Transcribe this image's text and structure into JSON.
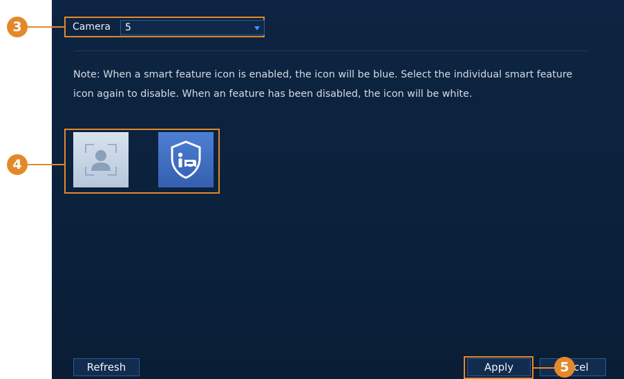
{
  "camera": {
    "label": "Camera",
    "value": "5"
  },
  "note": "Note: When a smart feature icon is enabled, the icon will be blue. Select the individual smart feature icon again to disable. When an feature has been disabled, the icon will be white.",
  "features": [
    {
      "name": "face-detection",
      "state": "disabled"
    },
    {
      "name": "vehicle-detection",
      "state": "enabled"
    }
  ],
  "buttons": {
    "refresh": "Refresh",
    "apply": "Apply",
    "cancel_visible": "cel"
  },
  "callouts": {
    "c3": "3",
    "c4": "4",
    "c5": "5"
  },
  "colors": {
    "panel": "#0c223e",
    "accent_orange": "#e3892a",
    "enabled_blue": "#4a7bd0",
    "disabled_white": "#d8e2ee"
  }
}
